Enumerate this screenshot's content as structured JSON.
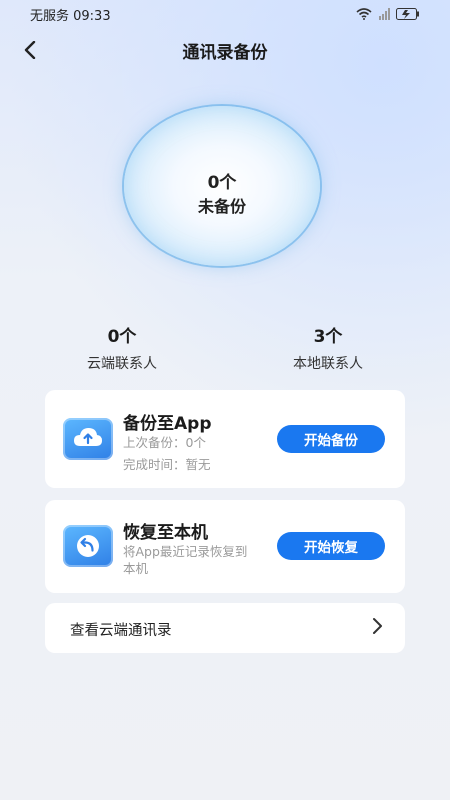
{
  "status_bar": {
    "carrier_time": "无服务 09:33"
  },
  "header": {
    "title": "通讯录备份"
  },
  "summary": {
    "count": "0个",
    "label": "未备份"
  },
  "stats": [
    {
      "value": "0个",
      "label": "云端联系人"
    },
    {
      "value": "3个",
      "label": "本地联系人"
    }
  ],
  "backup_card": {
    "title": "备份至App",
    "line1": "上次备份：0个",
    "line2": "完成时间：暂无",
    "button": "开始备份"
  },
  "restore_card": {
    "title": "恢复至本机",
    "line1": "将App最近记录恢复到",
    "line2": "本机",
    "button": "开始恢复"
  },
  "cloud_link": {
    "label": "查看云端通讯录"
  },
  "colors": {
    "accent": "#1a78f0",
    "icon_gradient": [
      "#5db8ff",
      "#2f7fe6"
    ]
  }
}
